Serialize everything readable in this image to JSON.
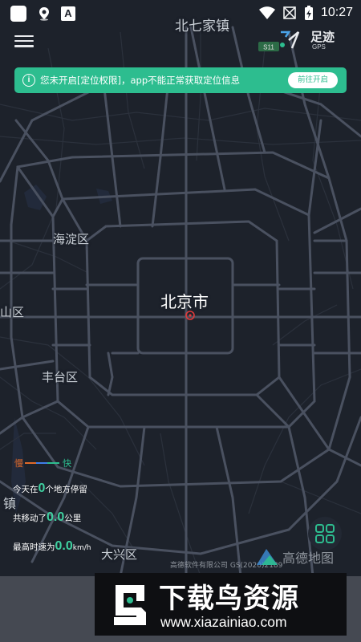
{
  "status_bar": {
    "time": "10:27",
    "notif_text": "A"
  },
  "logo": {
    "text": "足迹",
    "sub": "GPS"
  },
  "banner": {
    "icon": "i",
    "message": "您未开启[定位权限]，app不能正常获取定位信息",
    "button": "前往开启"
  },
  "map": {
    "labels": {
      "north": "北七家镇",
      "haidian": "海淀区",
      "beijing": "北京市",
      "shan": "山区",
      "fengtai": "丰台区",
      "daxing": "大兴区",
      "zhen": "镇"
    },
    "road_badge": "S11",
    "attribution": "高德软件有限公司 GS(2020)2189",
    "provider": "高德地图"
  },
  "legend": {
    "slow": "慢",
    "fast": "快"
  },
  "stats": {
    "stops_prefix": "今天在",
    "stops_value": "0",
    "stops_suffix": "个地方停留",
    "distance_prefix": "共移动了",
    "distance_value": "0.0",
    "distance_suffix": "公里",
    "speed_prefix": "最高时速为",
    "speed_value": "0.0",
    "speed_suffix": "km/h"
  },
  "watermark": {
    "title": "下载鸟资源",
    "url": "www.xiazainiao.com"
  },
  "colors": {
    "accent": "#2dbd8f",
    "map_bg": "#1d222b",
    "road": "#4a5160",
    "text_green": "#3fd0a0"
  }
}
